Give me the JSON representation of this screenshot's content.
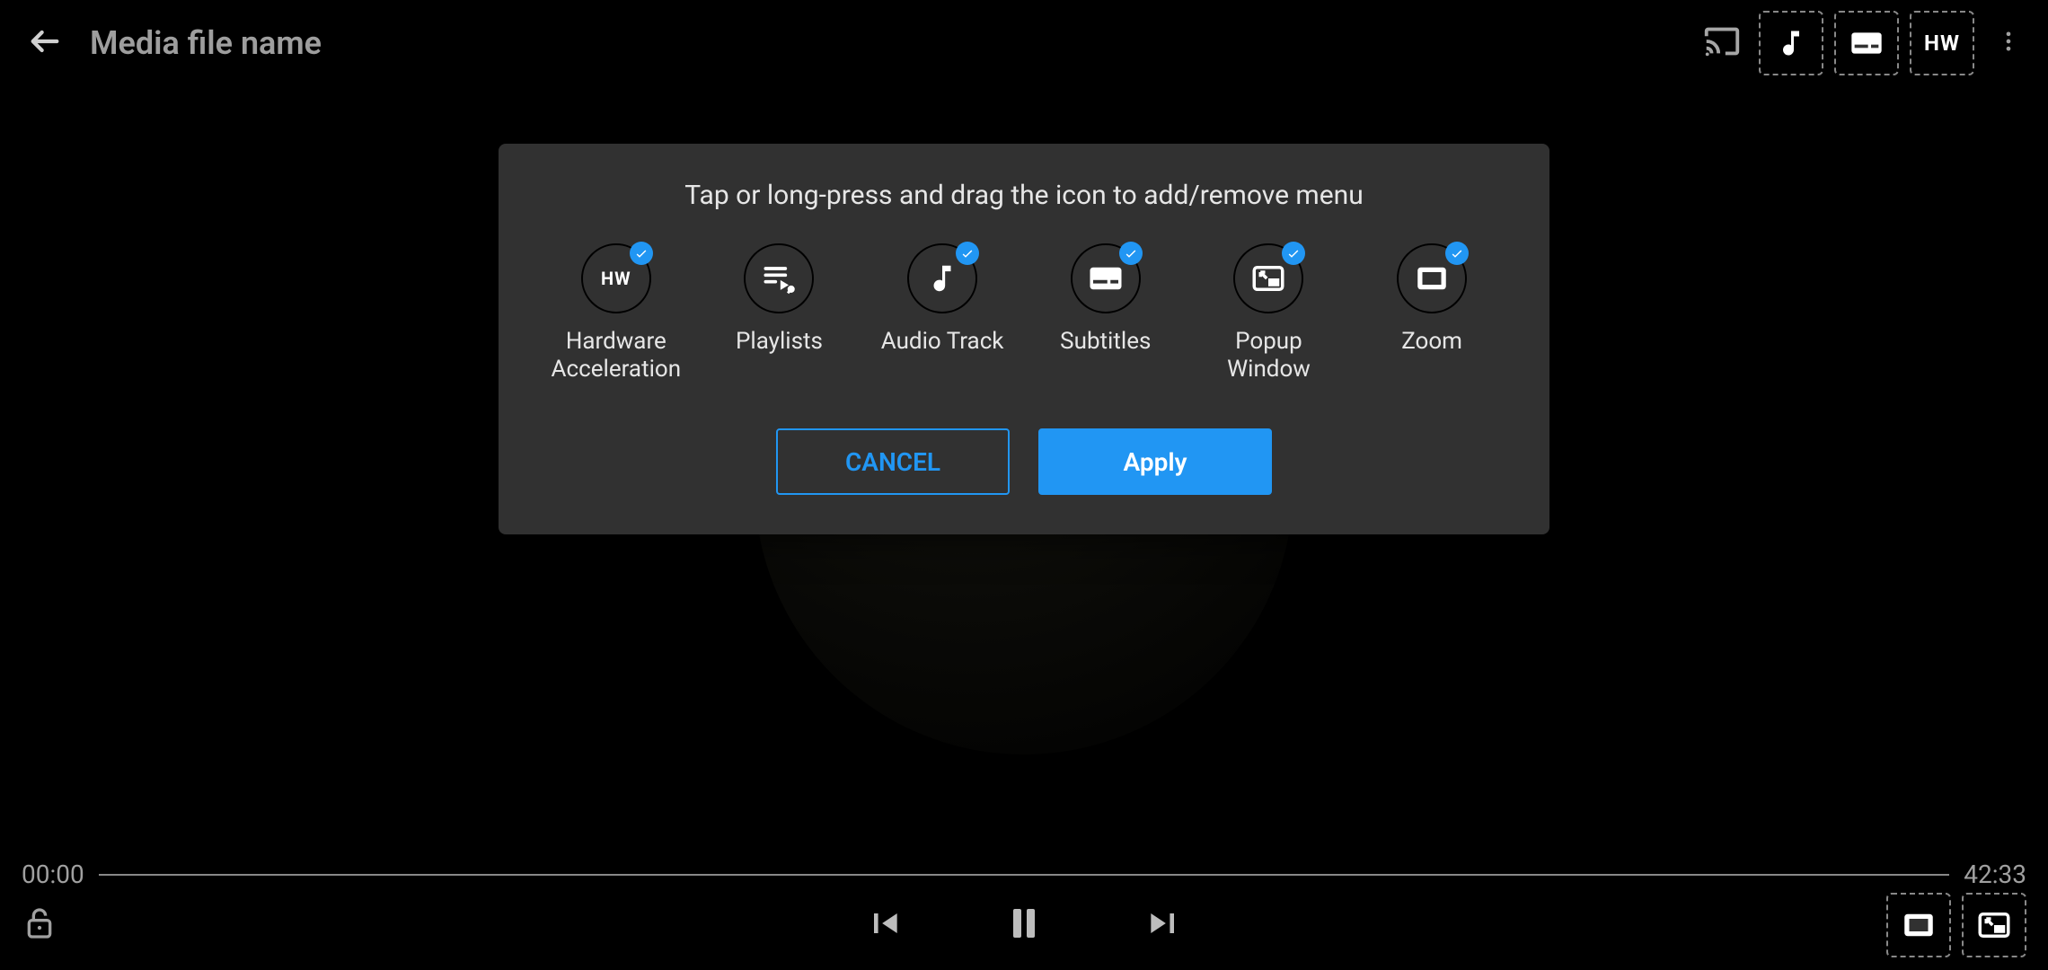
{
  "header": {
    "title": "Media file name",
    "slots": {
      "audio": "audio-track-icon",
      "subtitles": "subtitles-icon",
      "hw_label": "HW"
    }
  },
  "timeline": {
    "current": "00:00",
    "total": "42:33"
  },
  "dialog": {
    "title": "Tap or long-press and drag the icon to add/remove menu",
    "options": [
      {
        "id": "hw",
        "label": "Hardware Acceleration",
        "hw_text": "HW",
        "checked": true
      },
      {
        "id": "playlist",
        "label": "Playlists",
        "checked": false
      },
      {
        "id": "audio",
        "label": "Audio Track",
        "checked": true
      },
      {
        "id": "subs",
        "label": "Subtitles",
        "checked": true
      },
      {
        "id": "pip",
        "label": "Popup Window",
        "checked": true
      },
      {
        "id": "zoom",
        "label": "Zoom",
        "checked": true
      }
    ],
    "buttons": {
      "cancel": "CANCEL",
      "apply": "Apply"
    }
  }
}
